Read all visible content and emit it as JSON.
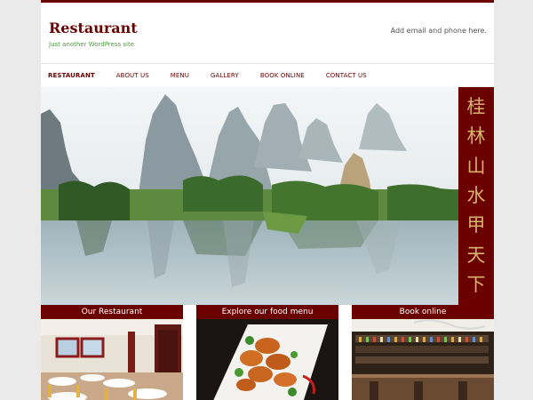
{
  "site": {
    "title": "Restaurant",
    "tagline": "Just another WordPress site",
    "contact": "Add email and phone here."
  },
  "nav": {
    "items": [
      {
        "label": "RESTAURANT",
        "active": true
      },
      {
        "label": "ABOUT US"
      },
      {
        "label": "MENU"
      },
      {
        "label": "GALLERY"
      },
      {
        "label": "BOOK ONLINE"
      },
      {
        "label": "CONTACT US"
      }
    ]
  },
  "banner": {
    "characters": [
      "桂",
      "林",
      "山",
      "水",
      "甲",
      "天",
      "下"
    ]
  },
  "promos": [
    {
      "title": "Our Restaurant"
    },
    {
      "title": "Explore our food menu"
    },
    {
      "title": "Book online"
    }
  ],
  "colors": {
    "brand": "#6b0000",
    "tagline": "#4a9c3a",
    "banner_text": "#d8b26a"
  }
}
